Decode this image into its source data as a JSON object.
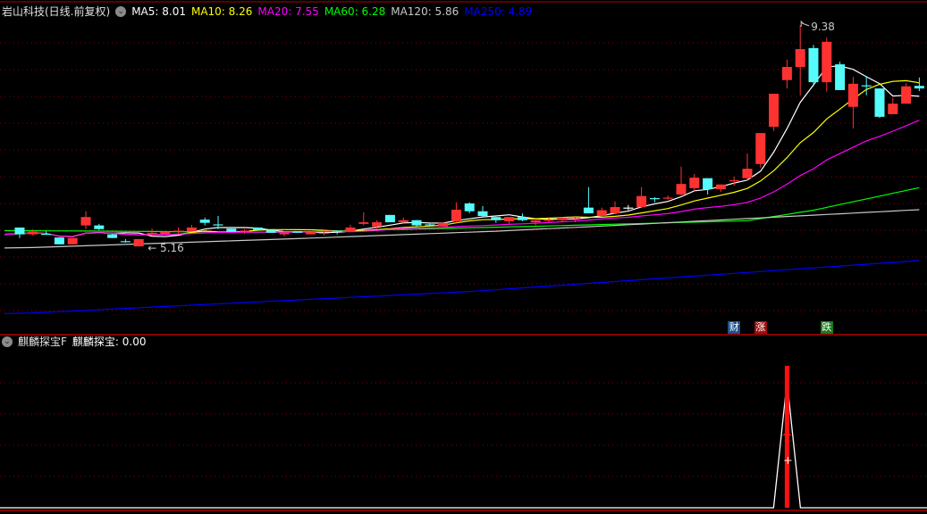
{
  "header": {
    "title": "岩山科技(日线.前复权)",
    "ma": [
      {
        "label": "MA5: 8.01",
        "color": "#ffffff"
      },
      {
        "label": "MA10: 8.26",
        "color": "#ffff00"
      },
      {
        "label": "MA20: 7.55",
        "color": "#ff00ff"
      },
      {
        "label": "MA60: 6.28",
        "color": "#00ff00"
      },
      {
        "label": "MA120: 5.86",
        "color": "#c8c8c8"
      },
      {
        "label": "MA250: 4.89",
        "color": "#0000ff"
      }
    ]
  },
  "indicator_header": {
    "name": "麒麟探宝F",
    "value_label": "麒麟探宝: 0.00"
  },
  "markers": [
    {
      "text": "财",
      "candle": 54,
      "color": "#1e4f8a"
    },
    {
      "text": "涨",
      "candle": 56,
      "color": "#a01010"
    },
    {
      "text": "跌",
      "candle": 61,
      "color": "#1a7a1a"
    }
  ],
  "colors": {
    "up": "#ff3232",
    "down": "#54fcfc",
    "grid": "#8b0000",
    "border": "#b00000"
  },
  "chart_data": [
    {
      "type": "candlestick",
      "title": "岩山科技(日线.前复权)",
      "ylim": [
        3.6,
        9.6
      ],
      "annotations": [
        {
          "text": "9.38",
          "candle": 59,
          "price": 9.38,
          "kind": "high"
        },
        {
          "text": "5.16",
          "candle": 9,
          "price": 5.16,
          "kind": "low"
        }
      ],
      "ohlc": [
        [
          5.52,
          5.52,
          5.32,
          5.39
        ],
        [
          5.39,
          5.49,
          5.37,
          5.44
        ],
        [
          5.4,
          5.45,
          5.39,
          5.39
        ],
        [
          5.33,
          5.33,
          5.2,
          5.2
        ],
        [
          5.2,
          5.32,
          5.2,
          5.32
        ],
        [
          5.56,
          5.83,
          5.49,
          5.72
        ],
        [
          5.56,
          5.59,
          5.47,
          5.49
        ],
        [
          5.39,
          5.4,
          5.32,
          5.32
        ],
        [
          5.26,
          5.3,
          5.23,
          5.25
        ],
        [
          5.16,
          5.3,
          5.16,
          5.3
        ],
        [
          5.39,
          5.5,
          5.37,
          5.42
        ],
        [
          5.4,
          5.44,
          5.4,
          5.44
        ],
        [
          5.45,
          5.52,
          5.39,
          5.46
        ],
        [
          5.45,
          5.57,
          5.45,
          5.52
        ],
        [
          5.67,
          5.71,
          5.56,
          5.61
        ],
        [
          5.58,
          5.74,
          5.49,
          5.57
        ],
        [
          5.5,
          5.5,
          5.44,
          5.44
        ],
        [
          5.45,
          5.49,
          5.4,
          5.46
        ],
        [
          5.52,
          5.52,
          5.47,
          5.47
        ],
        [
          5.47,
          5.47,
          5.42,
          5.42
        ],
        [
          5.39,
          5.45,
          5.35,
          5.42
        ],
        [
          5.45,
          5.45,
          5.42,
          5.42
        ],
        [
          5.39,
          5.44,
          5.39,
          5.44
        ],
        [
          5.4,
          5.49,
          5.37,
          5.42
        ],
        [
          5.46,
          5.47,
          5.39,
          5.45
        ],
        [
          5.45,
          5.57,
          5.45,
          5.52
        ],
        [
          5.59,
          5.81,
          5.56,
          5.62
        ],
        [
          5.54,
          5.66,
          5.5,
          5.62
        ],
        [
          5.76,
          5.76,
          5.62,
          5.62
        ],
        [
          5.62,
          5.71,
          5.61,
          5.66
        ],
        [
          5.66,
          5.66,
          5.54,
          5.56
        ],
        [
          5.58,
          5.61,
          5.54,
          5.57
        ],
        [
          5.54,
          5.61,
          5.54,
          5.61
        ],
        [
          5.64,
          6.0,
          5.61,
          5.86
        ],
        [
          5.98,
          6.0,
          5.79,
          5.83
        ],
        [
          5.83,
          5.93,
          5.72,
          5.74
        ],
        [
          5.72,
          5.72,
          5.61,
          5.66
        ],
        [
          5.64,
          5.72,
          5.59,
          5.72
        ],
        [
          5.72,
          5.79,
          5.64,
          5.66
        ],
        [
          5.62,
          5.66,
          5.56,
          5.66
        ],
        [
          5.66,
          5.72,
          5.62,
          5.67
        ],
        [
          5.66,
          5.72,
          5.62,
          5.71
        ],
        [
          5.7,
          5.74,
          5.62,
          5.71
        ],
        [
          5.9,
          6.29,
          5.79,
          5.79
        ],
        [
          5.74,
          5.9,
          5.74,
          5.85
        ],
        [
          5.79,
          6.02,
          5.79,
          5.91
        ],
        [
          5.9,
          5.95,
          5.85,
          5.9
        ],
        [
          5.91,
          6.29,
          5.91,
          6.12
        ],
        [
          6.08,
          6.1,
          6.0,
          6.07
        ],
        [
          6.08,
          6.13,
          6.05,
          6.09
        ],
        [
          6.15,
          6.68,
          6.13,
          6.35
        ],
        [
          6.27,
          6.54,
          6.22,
          6.47
        ],
        [
          6.46,
          6.46,
          6.15,
          6.25
        ],
        [
          6.25,
          6.34,
          6.2,
          6.34
        ],
        [
          6.4,
          6.49,
          6.32,
          6.42
        ],
        [
          6.46,
          6.93,
          6.42,
          6.64
        ],
        [
          6.73,
          7.32,
          6.66,
          7.32
        ],
        [
          7.44,
          8.07,
          7.36,
          8.07
        ],
        [
          8.33,
          8.72,
          8.17,
          8.58
        ],
        [
          8.58,
          9.38,
          8.04,
          8.92
        ],
        [
          8.94,
          9.0,
          8.21,
          8.29
        ],
        [
          8.29,
          9.14,
          8.11,
          9.06
        ],
        [
          8.63,
          8.68,
          8.14,
          8.14
        ],
        [
          7.82,
          8.39,
          7.41,
          8.26
        ],
        [
          8.23,
          8.41,
          8.04,
          8.22
        ],
        [
          8.17,
          8.17,
          7.61,
          7.63
        ],
        [
          7.68,
          7.99,
          7.68,
          7.88
        ],
        [
          7.88,
          8.27,
          7.88,
          8.21
        ],
        [
          8.22,
          8.38,
          8.12,
          8.17
        ]
      ],
      "computed_ma": [
        {
          "name": "MA5",
          "period": 5,
          "color": "#ffffff"
        },
        {
          "name": "MA10",
          "period": 10,
          "color": "#ffff00"
        },
        {
          "name": "MA20",
          "period": 20,
          "color": "#ff00ff"
        }
      ],
      "anchored_ma": [
        {
          "name": "MA60",
          "color": "#00ff00",
          "anchors": [
            [
              0,
              5.46
            ],
            [
              20,
              5.43
            ],
            [
              40,
              5.55
            ],
            [
              55,
              5.65
            ],
            [
              60,
              5.85
            ],
            [
              68,
              6.28
            ]
          ]
        },
        {
          "name": "MA120",
          "color": "#c8c8c8",
          "anchors": [
            [
              0,
              5.13
            ],
            [
              20,
              5.3
            ],
            [
              36,
              5.45
            ],
            [
              45,
              5.56
            ],
            [
              68,
              5.86
            ]
          ]
        },
        {
          "name": "MA250",
          "color": "#0000ff",
          "anchors": [
            [
              0,
              3.88
            ],
            [
              34,
              4.3
            ],
            [
              68,
              4.89
            ]
          ]
        }
      ]
    },
    {
      "type": "line",
      "title": "麒麟探宝F",
      "ylim": [
        0,
        1.1
      ],
      "spike_candle": 58,
      "values_note": "zero except spike",
      "spike_value": 1.0
    }
  ]
}
